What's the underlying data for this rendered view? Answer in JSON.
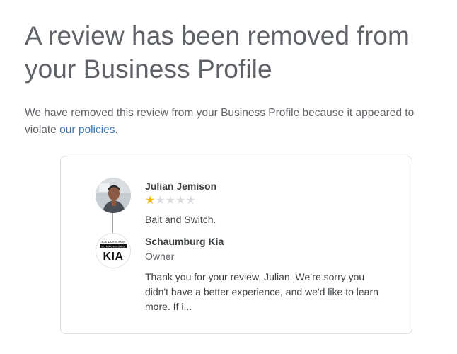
{
  "headline": "A review has been removed from your Business Profile",
  "intro": {
    "text": "We have removed this review from your Business Profile because it appeared to violate ",
    "link_text": "our policies",
    "suffix": "."
  },
  "review": {
    "reviewer_name": "Julian Jemison",
    "rating": 1,
    "rating_max": 5,
    "stars": [
      "★",
      "★",
      "★",
      "★",
      "★"
    ],
    "text": "Bait and Switch."
  },
  "owner_reply": {
    "business_name": "Schaumburg Kia",
    "role": "Owner",
    "logo_top_text": "JOE COHN MAN",
    "logo_mid_text": "SCHAUMBURG",
    "logo_brand": "KIA",
    "text": "Thank you for your review, Julian. We’re sorry you didn't have a better experience, and we'd like to learn more. If i..."
  },
  "colors": {
    "link": "#3c78b8",
    "star_filled": "#f4b400",
    "star_empty": "#dadce0"
  },
  "icons": {
    "reviewer_avatar": "person-photo-avatar",
    "owner_avatar": "kia-dealer-logo"
  }
}
